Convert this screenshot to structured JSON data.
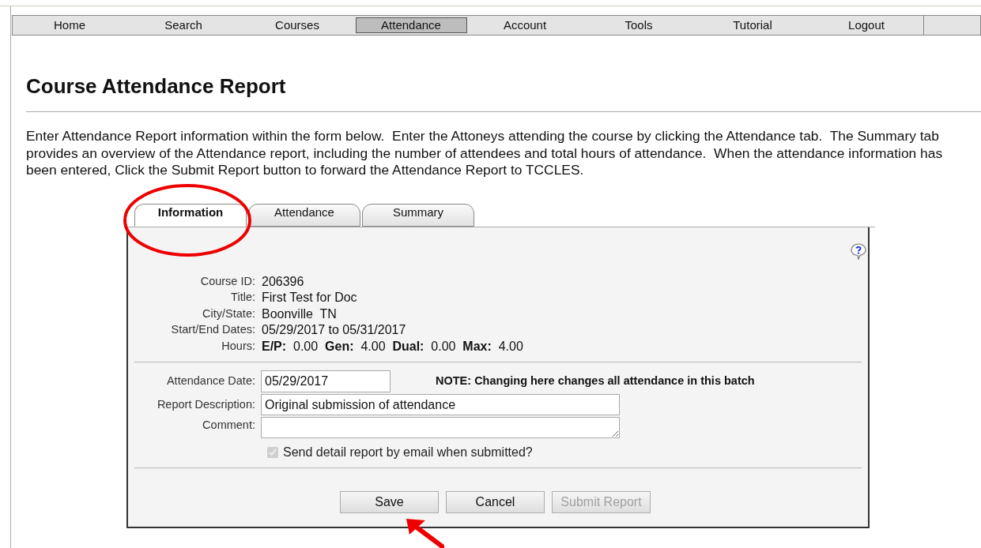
{
  "nav": [
    {
      "label": "Home",
      "selected": false
    },
    {
      "label": "Search",
      "selected": false
    },
    {
      "label": "Courses",
      "selected": false
    },
    {
      "label": "Attendance",
      "selected": true
    },
    {
      "label": "Account",
      "selected": false
    },
    {
      "label": "Tools",
      "selected": false
    },
    {
      "label": "Tutorial",
      "selected": false
    },
    {
      "label": "Logout",
      "selected": false
    }
  ],
  "page_title": "Course Attendance Report",
  "intro": "Enter Attendance Report information within the form below.  Enter the Attoneys attending the course by clicking the Attendance tab.  The Summary tab provides an overview of the Attendance report, including the number of attendees and total hours of attendance.  When the attendance information has been entered, Click the Submit Report button to forward the Attendance Report to TCCLES.",
  "tabs": [
    {
      "label": "Information",
      "selected": true
    },
    {
      "label": "Attendance",
      "selected": false
    },
    {
      "label": "Summary",
      "selected": false
    }
  ],
  "course_info": [
    {
      "label": "Course ID:",
      "value": "206396"
    },
    {
      "label": "Title:",
      "value": "First Test for Doc"
    },
    {
      "label": "City/State:",
      "value": "Boonville  TN"
    },
    {
      "label": "Start/End Dates:",
      "value": "05/29/2017 to 05/31/2017"
    },
    {
      "label": "Hours:",
      "value": "**E/P:**  0.00  **Gen:**  4.00  **Dual:**  0.00  **Max:**  4.00"
    }
  ],
  "form": {
    "attendance_date": {
      "label": "Attendance Date:",
      "value": "05/29/2017"
    },
    "note": "NOTE: Changing here changes all attendance in this batch",
    "report_description": {
      "label": "Report Description:",
      "value": "Original submission of attendance"
    },
    "comment": {
      "label": "Comment:"
    },
    "email_checkbox": {
      "label": "Send detail report by email when submitted?",
      "checked": true,
      "disabled": true
    }
  },
  "buttons": [
    {
      "label": "Save",
      "disabled": false
    },
    {
      "label": "Cancel",
      "disabled": false
    },
    {
      "label": "Submit Report",
      "disabled": true
    }
  ]
}
